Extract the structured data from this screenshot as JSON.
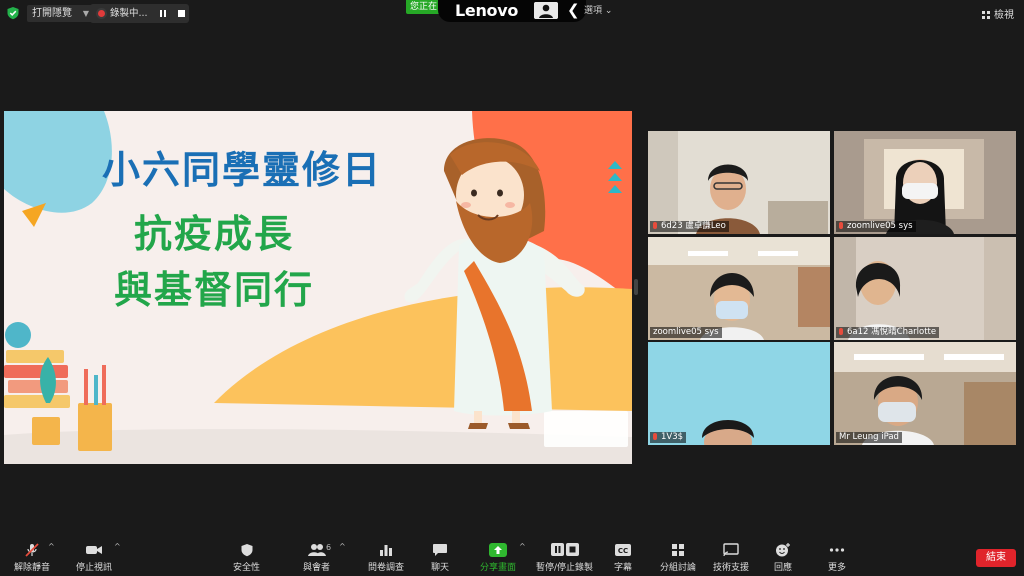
{
  "topbar": {
    "subtitle_label": "打開隱覽",
    "recording_label": "錄製中...",
    "speaking_label": "您正在",
    "overlay_brand": "Lenovo",
    "view_options_label": "選項",
    "view_label": "檢視"
  },
  "slide": {
    "line1": "小六同學靈修日",
    "line2": "抗疫成長",
    "line3": "與基督同行"
  },
  "participants": [
    {
      "name": "6d23 盧卓謙Leo"
    },
    {
      "name": "zoomlive05 sys"
    },
    {
      "name": "zoomlive05 sys"
    },
    {
      "name": "6a12 馮悅晴Charlotte"
    },
    {
      "name": "1V3$"
    },
    {
      "name": "Mr Leung iPad"
    }
  ],
  "toolbar": {
    "unmute": "解除靜音",
    "stop_video": "停止視訊",
    "security": "安全性",
    "participants": "與會者",
    "participant_count": "6",
    "polls": "問卷調查",
    "chat": "聊天",
    "share_screen": "分享畫面",
    "pause_recording": "暫停/停止錄製",
    "captions": "字幕",
    "breakout": "分組討論",
    "tech_support": "技術支援",
    "reactions": "回應",
    "more": "更多",
    "end": "結束"
  },
  "colors": {
    "accent_green": "#2fb82f",
    "end_red": "#e0242b",
    "active_speaker": "#c4d13a",
    "slide_blue": "#1a6fb5",
    "slide_green": "#22a64a"
  }
}
